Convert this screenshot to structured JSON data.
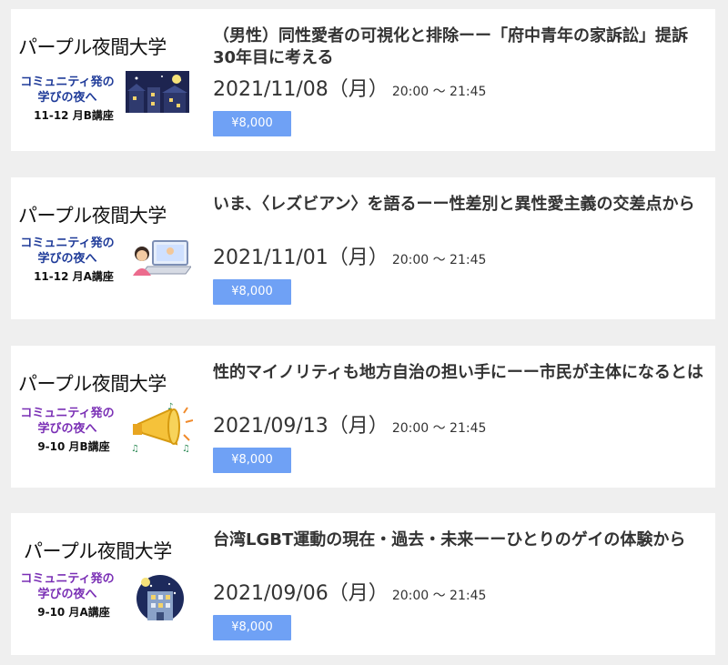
{
  "events": [
    {
      "thumb": {
        "title": "パープル夜間大学",
        "sub": "コミュニティ発の\n学びの夜へ",
        "code": "11-12 月B講座",
        "sub_color": "#1f3b99",
        "illus": "night-town-icon"
      },
      "title": "（男性）同性愛者の可視化と排除ーー「府中青年の家訴訟」提訴30年目に考える",
      "date": "2021/11/08（月）",
      "time": "20:00 〜 21:45",
      "price": "¥8,000"
    },
    {
      "thumb": {
        "title": "パープル夜間大学",
        "sub": "コミュニティ発の\n学びの夜へ",
        "code": "11-12 月A講座",
        "sub_color": "#1f3b99",
        "illus": "online-lecture-icon"
      },
      "title": "いま、〈レズビアン〉を語るーー性差別と異性愛主義の交差点から",
      "date": "2021/11/01（月）",
      "time": "20:00 〜 21:45",
      "price": "¥8,000"
    },
    {
      "thumb": {
        "title": "パープル夜間大学",
        "sub": "コミュニティ発の\n学びの夜へ",
        "code": "9-10 月B講座",
        "sub_color": "#7a2fb5",
        "illus": "megaphone-icon"
      },
      "title": "性的マイノリティも地方自治の担い手にーー市民が主体になるとは",
      "date": "2021/09/13（月）",
      "time": "20:00 〜 21:45",
      "price": "¥8,000"
    },
    {
      "thumb": {
        "title": "パープル夜間大学",
        "sub": "コミュニティ発の\n学びの夜へ",
        "code": "9-10 月A講座",
        "sub_color": "#7a2fb5",
        "illus": "night-building-icon"
      },
      "title": "台湾LGBT運動の現在・過去・未来ーーひとりのゲイの体験から",
      "date": "2021/09/06（月）",
      "time": "20:00 〜 21:45",
      "price": "¥8,000"
    }
  ]
}
